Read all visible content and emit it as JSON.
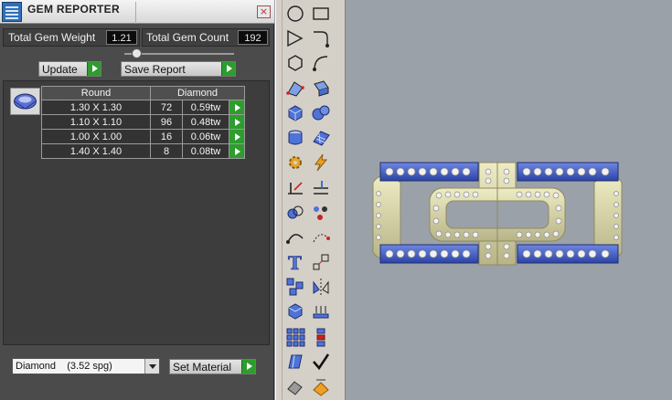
{
  "panel": {
    "title": "GEM REPORTER",
    "close_glyph": "×",
    "total_weight_label": "Total Gem Weight",
    "total_weight_value": "1.21",
    "total_count_label": "Total Gem Count",
    "total_count_value": "192",
    "update_label": "Update",
    "save_report_label": "Save Report",
    "table": {
      "header_shape": "Round",
      "header_material": "Diamond",
      "rows": [
        {
          "size": "1.30 X 1.30",
          "count": "72",
          "weight": "0.59tw"
        },
        {
          "size": "1.10 X 1.10",
          "count": "96",
          "weight": "0.48tw"
        },
        {
          "size": "1.00 X 1.00",
          "count": "16",
          "weight": "0.06tw"
        },
        {
          "size": "1.40 X 1.40",
          "count": "8",
          "weight": "0.08tw"
        }
      ]
    },
    "material_select_value": "Diamond    (3.52 spg)",
    "set_material_label": "Set Material"
  },
  "icons": {
    "close": "close-icon",
    "gem_thumb": "gem-thumbnail-icon",
    "title": "gem-reporter-app-icon"
  },
  "colors": {
    "accent_green": "#2d9d2d",
    "panel_bg": "#4b4b4b",
    "viewport_bg": "#9ba1a8",
    "gold": "#d8d6a6",
    "enamel_blue": "#3f58b8"
  },
  "toolbar": {
    "tools": [
      "circle-tool-icon",
      "rectangle-tool-icon",
      "polyline-tool-icon",
      "fillet-curve-tool-icon",
      "polygon-tool-icon",
      "arc-tool-icon",
      "surface-points-tool-icon",
      "extrude-surface-tool-icon",
      "box-solid-tool-icon",
      "sphere-solid-tool-icon",
      "cylinder-solid-tool-icon",
      "mesh-surface-tool-icon",
      "gear-tool-icon",
      "lightning-tool-icon",
      "trim-tool-icon",
      "split-tool-icon",
      "boolean-tool-icon",
      "points-tool-icon",
      "curve-tool-icon",
      "curve-points-tool-icon",
      "text-tool-icon",
      "scale-tool-icon",
      "array-tool-icon",
      "mirror-tool-icon",
      "cube-edit-tool-icon",
      "gem-setting-tool-icon",
      "grid-array-tool-icon",
      "stack-tool-icon",
      "shell-tool-icon",
      "checkmark-tool-icon",
      "render-tool-icon",
      "material-tool-icon"
    ]
  }
}
